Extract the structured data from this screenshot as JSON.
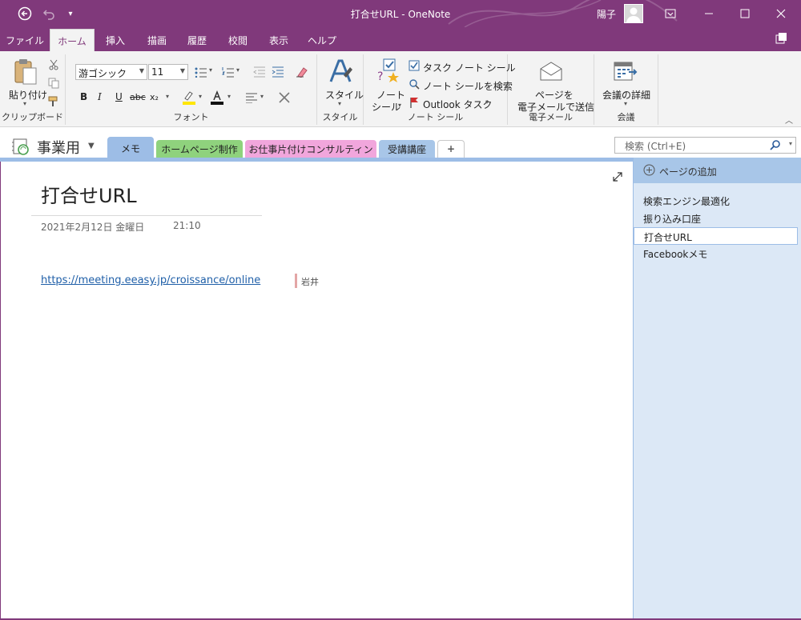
{
  "window": {
    "title": "打合せURL - OneNote",
    "user": "陽子",
    "colors": {
      "accent": "#80397b",
      "section_memo": "#9dbde6",
      "section_homepage": "#8fd27d",
      "section_consulting": "#f1a6dc",
      "section_course": "#a8c6e8"
    }
  },
  "menu": {
    "tabs": [
      "ファイル",
      "ホーム",
      "挿入",
      "描画",
      "履歴",
      "校閲",
      "表示",
      "ヘルプ"
    ]
  },
  "ribbon": {
    "clipboard": {
      "paste_label": "貼り付け",
      "group_label": "クリップボード"
    },
    "font": {
      "font_name": "游ゴシック",
      "font_size": "11",
      "bold": "B",
      "italic": "I",
      "underline": "U",
      "strike": "abc",
      "subscript": "x₂",
      "group_label": "フォント"
    },
    "styles": {
      "styles_label": "スタイル",
      "group_label": "スタイル"
    },
    "tags": {
      "note_tag_line1": "ノート",
      "note_tag_line2": "シール",
      "task_tag": "タスク ノート シール",
      "find_tags": "ノート シールを検索",
      "outlook_tasks": "Outlook タスク",
      "group_label": "ノート シール"
    },
    "email": {
      "email_line1": "ページを",
      "email_line2": "電子メールで送信",
      "group_label": "電子メール"
    },
    "meetings": {
      "meeting_details": "会議の詳細",
      "group_label": "会議"
    }
  },
  "notebook": {
    "name": "事業用",
    "sections": [
      "メモ",
      "ホームページ制作",
      "お仕事片付けコンサルティング",
      "受講講座"
    ],
    "add_section": "+"
  },
  "search": {
    "placeholder": "検索 (Ctrl+E)"
  },
  "page": {
    "title": "打合せURL",
    "date": "2021年2月12日 金曜日",
    "time": "21:10",
    "link": "https://meeting.eeasy.jp/croissance/online",
    "author": "岩井"
  },
  "pagelist": {
    "add_page": "ページの追加",
    "pages": [
      "検索エンジン最適化",
      "振り込み口座",
      "打合せURL",
      "Facebookメモ"
    ]
  }
}
